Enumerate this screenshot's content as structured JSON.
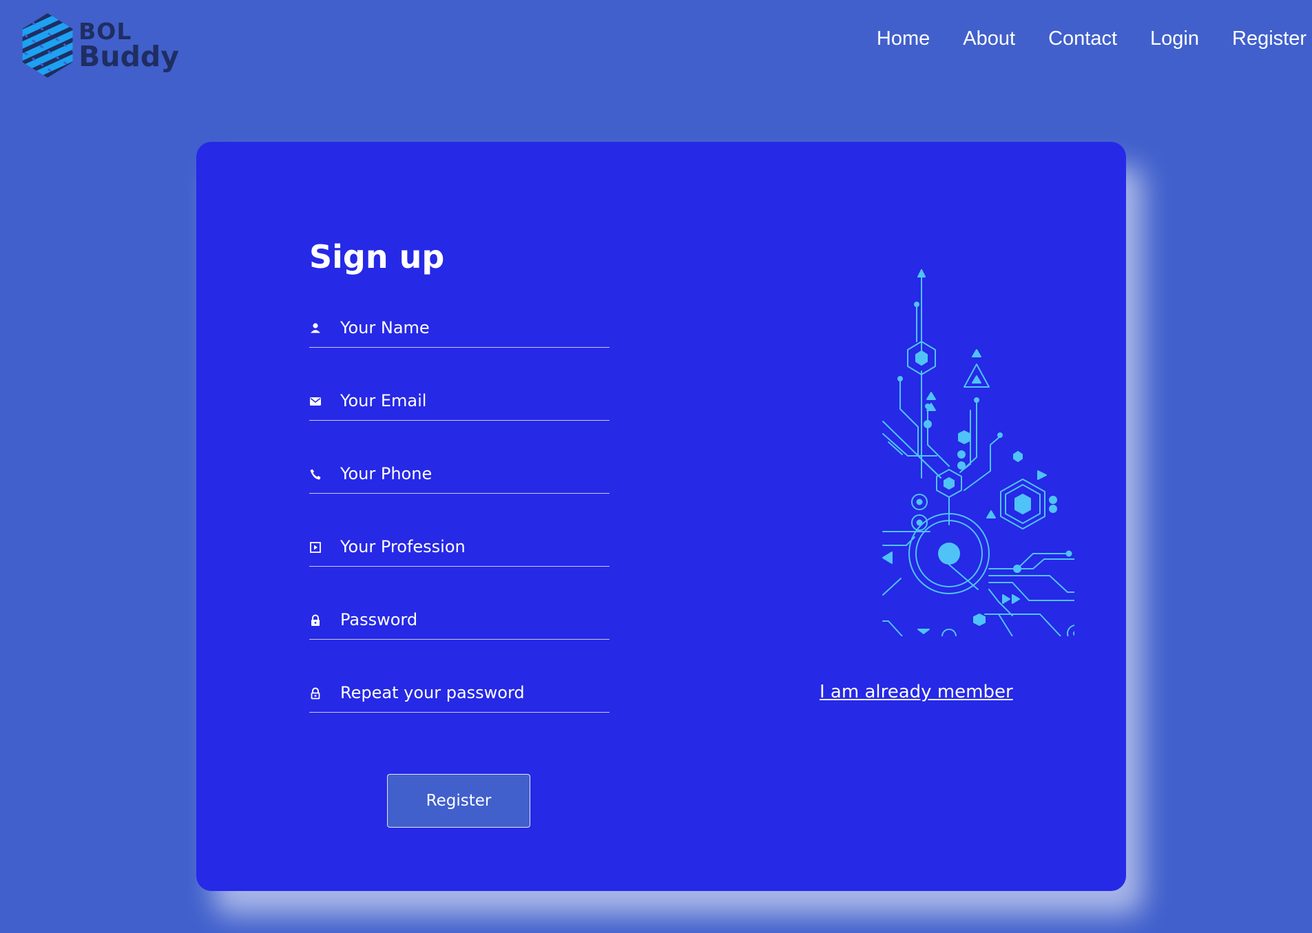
{
  "brand": {
    "line1": "BOL",
    "line2": "Buddy",
    "text_color": "#1f2e62",
    "logo_colors": [
      "#1da1f2",
      "#1f2e62"
    ]
  },
  "nav": {
    "items": [
      "Home",
      "About",
      "Contact",
      "Login",
      "Register"
    ]
  },
  "signup": {
    "title": "Sign up",
    "fields": [
      {
        "icon": "user-icon",
        "placeholder": "Your Name"
      },
      {
        "icon": "envelope-icon",
        "placeholder": "Your Email"
      },
      {
        "icon": "phone-icon",
        "placeholder": "Your Phone"
      },
      {
        "icon": "profession-icon",
        "placeholder": "Your Profession"
      },
      {
        "icon": "lock-icon",
        "placeholder": "Password"
      },
      {
        "icon": "lock-outline-icon",
        "placeholder": "Repeat your password"
      }
    ],
    "register_button": "Register",
    "member_link": "I am already member"
  },
  "colors": {
    "page_bg": "#4160cc",
    "card_bg": "#2629e6",
    "accent": "#4fc3f7",
    "text": "#ffffff"
  }
}
